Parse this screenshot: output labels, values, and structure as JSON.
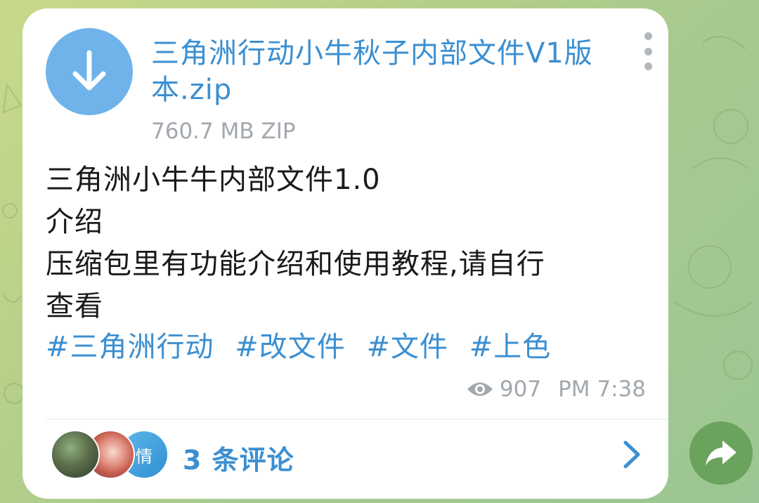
{
  "file": {
    "name": "三角洲行动小牛秋子内部文件V1版本.zip",
    "meta": "760.7 MB ZIP",
    "icon": "download-icon"
  },
  "message": {
    "lines": [
      "三角洲小牛牛内部文件1.0",
      "介绍",
      "压缩包里有功能介绍和使用教程,请自行",
      "查看"
    ],
    "tags": [
      "#三角洲行动",
      "#改文件",
      "#文件",
      "#上色"
    ]
  },
  "info": {
    "views": "907",
    "time": "PM 7:38"
  },
  "comments": {
    "label": "3 条评论",
    "avatar_text": "情"
  },
  "colors": {
    "accent": "#3b8fd1",
    "icon_bg": "#6fb3ea",
    "share_bg": "#6aa35c",
    "meta": "#a2a8ae"
  }
}
